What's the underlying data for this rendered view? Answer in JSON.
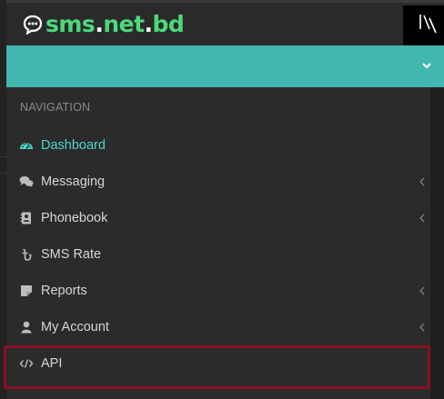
{
  "brand": {
    "name_part1": "sms",
    "name_dot1": ".",
    "name_part2": "net",
    "name_dot2": ".",
    "name_part3": "bd",
    "accent_color": "#4cd97b"
  },
  "header": {
    "toggle_icon": "chevron-down-icon",
    "bar_color": "#42b7b0"
  },
  "navigation": {
    "heading": "NAVIGATION",
    "items": [
      {
        "label": "Dashboard",
        "icon": "dashboard-gauge-icon",
        "active": true,
        "has_submenu": false
      },
      {
        "label": "Messaging",
        "icon": "chat-bubbles-icon",
        "active": false,
        "has_submenu": true
      },
      {
        "label": "Phonebook",
        "icon": "address-book-icon",
        "active": false,
        "has_submenu": true
      },
      {
        "label": "SMS Rate",
        "icon": "taka-currency-icon",
        "active": false,
        "has_submenu": false
      },
      {
        "label": "Reports",
        "icon": "sticky-note-icon",
        "active": false,
        "has_submenu": true
      },
      {
        "label": "My Account",
        "icon": "user-icon",
        "active": false,
        "has_submenu": true
      },
      {
        "label": "API",
        "icon": "code-icon",
        "active": false,
        "has_submenu": false
      }
    ]
  },
  "colors": {
    "active_text": "#4fd4cc",
    "highlight_border": "#8b0f24"
  }
}
